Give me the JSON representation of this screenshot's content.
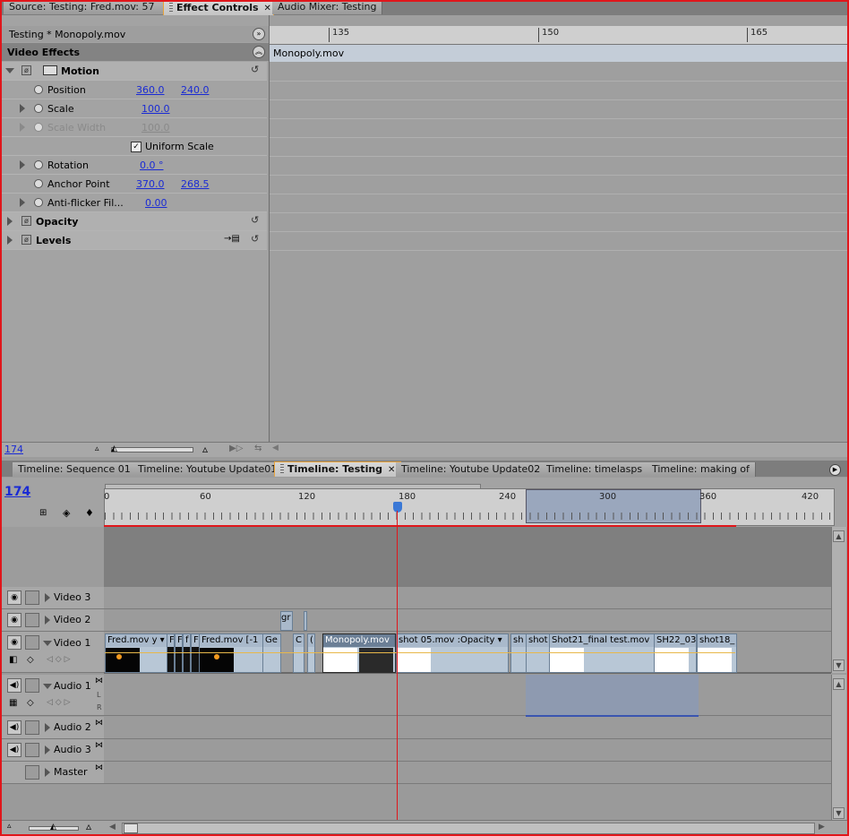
{
  "top_tabs": {
    "source": "Source: Testing: Fred.mov: 57",
    "effect_controls": "Effect Controls",
    "audio_mixer": "Audio Mixer: Testing"
  },
  "effect_controls": {
    "clip_title": "Testing * Monopoly.mov",
    "section": "Video Effects",
    "motion_label": "Motion",
    "position": {
      "label": "Position",
      "x": "360.0",
      "y": "240.0"
    },
    "scale": {
      "label": "Scale",
      "value": "100.0"
    },
    "scale_width": {
      "label": "Scale Width",
      "value": "100.0"
    },
    "uniform_scale": "Uniform Scale",
    "rotation": {
      "label": "Rotation",
      "value": "0.0 °"
    },
    "anchor_point": {
      "label": "Anchor Point",
      "x": "370.0",
      "y": "268.5"
    },
    "anti_flicker": {
      "label": "Anti-flicker Fil...",
      "value": "0.00"
    },
    "opacity_label": "Opacity",
    "levels_label": "Levels",
    "timecode": "174"
  },
  "ec_timeline": {
    "ticks": [
      "135",
      "150",
      "165"
    ],
    "clip_name": "Monopoly.mov"
  },
  "timeline_tabs": [
    "Timeline: Sequence 01",
    "Timeline: Youtube Update01",
    "Timeline: Testing",
    "Timeline: Youtube Update02",
    "Timeline: timelasps",
    "Timeline: making of"
  ],
  "timeline": {
    "timecode": "174",
    "ruler": [
      "0",
      "60",
      "120",
      "180",
      "240",
      "300",
      "360",
      "420"
    ]
  },
  "tracks": {
    "video3": "Video 3",
    "video2": "Video 2",
    "video1": "Video 1",
    "audio1": "Audio 1",
    "audio2": "Audio 2",
    "audio3": "Audio 3",
    "master": "Master",
    "audio1_l": "L",
    "audio1_r": "R"
  },
  "clips": {
    "fred1": "Fred.mov",
    "fred1_sub": "y",
    "f1": "F",
    "f2": "F",
    "f3": "f",
    "f4": "F",
    "fred2": "Fred.mov [-1",
    "ge": "Ge",
    "gr": "gr",
    "c": "C",
    "c2": "(",
    "monopoly": "Monopoly.mov",
    "shot05": "shot 05.mov",
    "opacity": ":Opacity",
    "sh": "sh",
    "shot": "shot",
    "shot21": "Shot21_final test.mov",
    "sh22": "SH22_03",
    "shot18": "shot18_"
  },
  "icons": {
    "panel_menu": "double-chevron-right-icon",
    "collapse": "double-chevron-up-icon",
    "reset": "reset-icon",
    "eye": "eye-icon",
    "speaker": "speaker-icon",
    "stopwatch": "stopwatch-icon"
  },
  "colors": {
    "frame_border": "#e0161b",
    "active_tab_border": "#e8a23a",
    "value_link": "#1a2bd4",
    "playhead": "#e0161b",
    "work_area": "#9aa7bd"
  }
}
